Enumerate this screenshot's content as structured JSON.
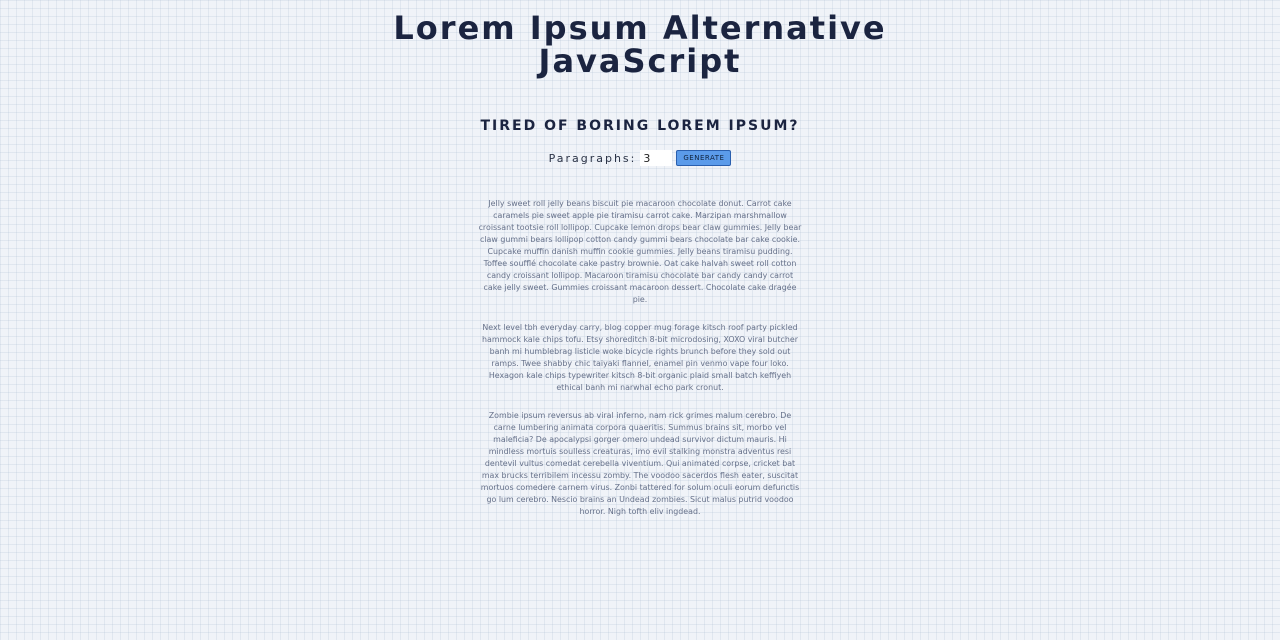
{
  "header": {
    "title_line1": "Lorem Ipsum Alternative",
    "title_line2": "JavaScript",
    "subtitle": "TIRED OF BORING LOREM IPSUM?"
  },
  "controls": {
    "paragraphs_label": "Paragraphs:",
    "paragraphs_value": "3",
    "generate_label": "GENERATE"
  },
  "output": {
    "paragraphs": [
      "Jelly sweet roll jelly beans biscuit pie macaroon chocolate donut. Carrot cake caramels pie sweet apple pie tiramisu carrot cake. Marzipan marshmallow croissant tootsie roll lollipop. Cupcake lemon drops bear claw gummies. Jelly bear claw gummi bears lollipop cotton candy gummi bears chocolate bar cake cookie. Cupcake muffin danish muffin cookie gummies. Jelly beans tiramisu pudding. Toffee soufflé chocolate cake pastry brownie. Oat cake halvah sweet roll cotton candy croissant lollipop. Macaroon tiramisu chocolate bar candy candy carrot cake jelly sweet. Gummies croissant macaroon dessert. Chocolate cake dragée pie.",
      "Next level tbh everyday carry, blog copper mug forage kitsch roof party pickled hammock kale chips tofu. Etsy shoreditch 8-bit microdosing, XOXO viral butcher banh mi humblebrag listicle woke bicycle rights brunch before they sold out ramps. Twee shabby chic taiyaki flannel, enamel pin venmo vape four loko. Hexagon kale chips typewriter kitsch 8-bit organic plaid small batch keffiyeh ethical banh mi narwhal echo park cronut.",
      "Zombie ipsum reversus ab viral inferno, nam rick grimes malum cerebro. De carne lumbering animata corpora quaeritis. Summus brains sit, morbo vel maleficia? De apocalypsi gorger omero undead survivor dictum mauris. Hi mindless mortuis soulless creaturas, imo evil stalking monstra adventus resi dentevil vultus comedat cerebella viventium. Qui animated corpse, cricket bat max brucks terribilem incessu zomby. The voodoo sacerdos flesh eater, suscitat mortuos comedere carnem virus. Zonbi tattered for solum oculi eorum defunctis go lum cerebro. Nescio brains an Undead zombies. Sicut malus putrid voodoo horror. Nigh tofth eliv ingdead."
    ]
  }
}
